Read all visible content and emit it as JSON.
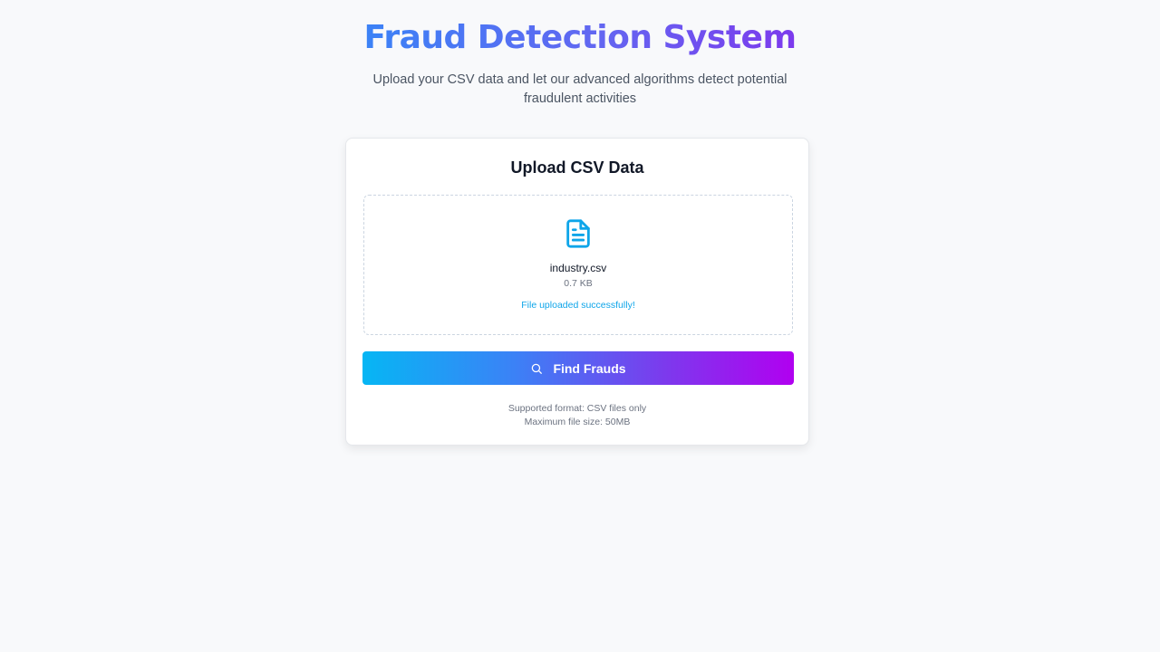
{
  "header": {
    "title": "Fraud Detection System",
    "subtitle": "Upload your CSV data and let our advanced algorithms detect potential fraudulent activities"
  },
  "upload_card": {
    "title": "Upload CSV Data",
    "file": {
      "icon": "file-text-icon",
      "name": "industry.csv",
      "size": "0.7 KB",
      "status": "File uploaded successfully!"
    },
    "button": {
      "icon": "search-icon",
      "label": "Find Frauds"
    },
    "notes": {
      "format": "Supported format: CSV files only",
      "max_size": "Maximum file size: 50MB"
    }
  },
  "colors": {
    "title_gradient_start": "#3b82f6",
    "title_gradient_end": "#7c3aed",
    "file_icon": "#0ea5e9",
    "status_text": "#0ea5e9",
    "button_gradient_start": "#06b6f4",
    "button_gradient_end": "#b100f0",
    "background": "#f8f9fb"
  }
}
